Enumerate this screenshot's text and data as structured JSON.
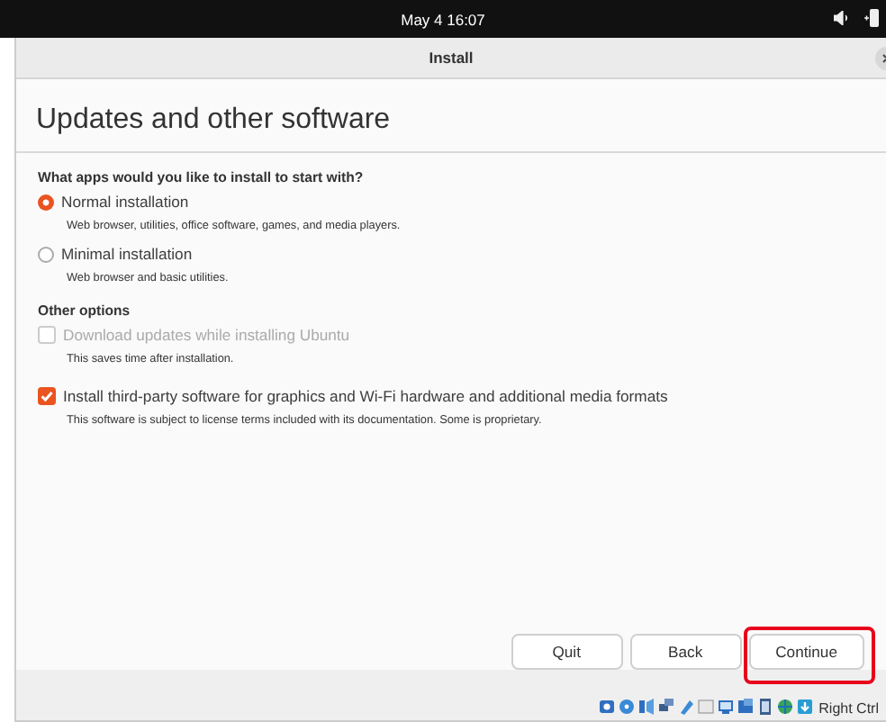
{
  "top_bar": {
    "clock": "May 4  16:07"
  },
  "window": {
    "title": "Install"
  },
  "page": {
    "heading": "Updates and other software",
    "question": "What apps would you like to install to start with?",
    "install_types": [
      {
        "label": "Normal installation",
        "description": "Web browser, utilities, office software, games, and media players.",
        "selected": true
      },
      {
        "label": "Minimal installation",
        "description": "Web browser and basic utilities.",
        "selected": false
      }
    ],
    "other_options_heading": "Other options",
    "options": [
      {
        "label": "Download updates while installing Ubuntu",
        "description": "This saves time after installation.",
        "checked": false,
        "disabled": true
      },
      {
        "label": "Install third-party software for graphics and Wi-Fi hardware and additional media formats",
        "description": "This software is subject to license terms included with its documentation. Some is proprietary.",
        "checked": true,
        "disabled": false
      }
    ]
  },
  "buttons": [
    {
      "label": "Quit",
      "highlighted": false
    },
    {
      "label": "Back",
      "highlighted": false
    },
    {
      "label": "Continue",
      "highlighted": true
    }
  ],
  "status_bar": {
    "host_key": "Right Ctrl"
  }
}
